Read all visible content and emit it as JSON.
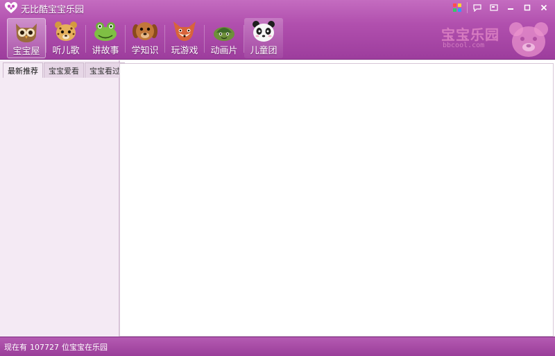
{
  "window": {
    "title": "无比酷宝宝乐园"
  },
  "title_controls": [
    {
      "name": "color-grid-icon",
      "glyph": "▦"
    },
    {
      "name": "chat-icon",
      "glyph": "💬"
    },
    {
      "name": "screen-icon",
      "glyph": "▣"
    },
    {
      "name": "minimize-icon",
      "glyph": "—"
    },
    {
      "name": "maximize-icon",
      "glyph": "□"
    },
    {
      "name": "close-icon",
      "glyph": "✕"
    }
  ],
  "nav": [
    {
      "label": "宝宝屋",
      "icon": "owl-icon"
    },
    {
      "label": "听儿歌",
      "icon": "leopard-icon"
    },
    {
      "label": "讲故事",
      "icon": "frog-icon"
    },
    {
      "label": "学知识",
      "icon": "dog-icon"
    },
    {
      "label": "玩游戏",
      "icon": "fox-icon"
    },
    {
      "label": "动画片",
      "icon": "turtle-icon"
    },
    {
      "label": "儿童团",
      "icon": "panda-icon"
    }
  ],
  "brand": {
    "text": "宝宝乐园",
    "url": "bbcool.com",
    "icon": "bear-icon"
  },
  "left_tabs": [
    "最新推荐",
    "宝宝爱看",
    "宝宝看过"
  ],
  "status": {
    "prefix": "现在有",
    "count": "107727",
    "suffix": "位宝宝在乐园"
  },
  "colors": {
    "header": "#b150ae",
    "status": "#9a3d99",
    "panel": "#f4eaf4"
  }
}
